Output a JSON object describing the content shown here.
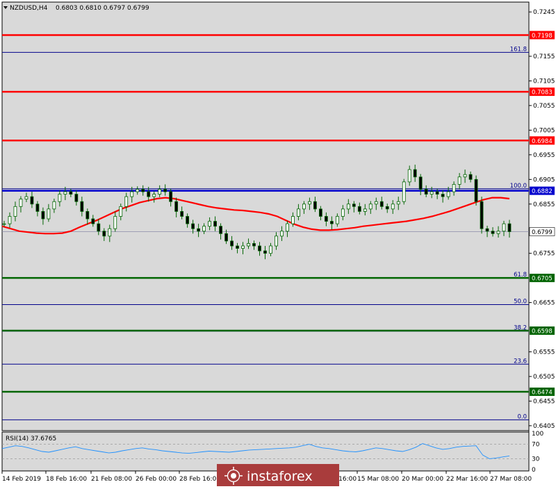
{
  "header": {
    "symbol": "NZDUSD,H4",
    "ohlc": "0.6803 0.6810 0.6797 0.6799"
  },
  "price_axis": {
    "ticks": [
      "0.7245",
      "0.7155",
      "0.7105",
      "0.7055",
      "0.7005",
      "0.6955",
      "0.6905",
      "0.6855",
      "0.6755",
      "0.6655",
      "0.6555",
      "0.6505",
      "0.6455",
      "0.6405"
    ]
  },
  "time_axis": {
    "ticks": [
      "14 Feb 2019",
      "18 Feb 16:00",
      "21 Feb 08:00",
      "26 Feb 00:00",
      "28 Feb 16:00",
      "13 Mar 16:00",
      "15 Mar 08:00",
      "20 Mar 00:00",
      "22 Mar 16:00",
      "27 Mar 08:00"
    ]
  },
  "rsi": {
    "title": "RSI(14) 37.6765",
    "scale": [
      "100",
      "70",
      "30",
      "0"
    ]
  },
  "watermark": "instaforex",
  "colors": {
    "red": "#ff0000",
    "green": "#006400",
    "fib": "#00008b",
    "current": "#0000cd",
    "rsi_line": "#1e90ff",
    "candle": "#006400"
  },
  "chart_data": {
    "type": "line",
    "instrument": "NZDUSD",
    "timeframe": "H4",
    "y_range": [
      0.6395,
      0.7265
    ],
    "levels": [
      {
        "price": 0.7198,
        "label": "0.7198",
        "color": "red"
      },
      {
        "price": 0.7083,
        "label": "0.7083",
        "color": "red"
      },
      {
        "price": 0.6984,
        "label": "0.6984",
        "color": "red"
      },
      {
        "price": 0.6882,
        "label": "0.6882",
        "color": "current"
      },
      {
        "price": 0.6705,
        "label": "0.6705",
        "color": "green"
      },
      {
        "price": 0.6598,
        "label": "0.6598",
        "color": "green"
      },
      {
        "price": 0.6474,
        "label": "0.6474",
        "color": "green"
      }
    ],
    "fib_levels": [
      {
        "price": 0.7163,
        "label": "161.8"
      },
      {
        "price": 0.6886,
        "label": "100.0"
      },
      {
        "price": 0.6705,
        "label": "61.8"
      },
      {
        "price": 0.6651,
        "label": "50.0"
      },
      {
        "price": 0.6597,
        "label": "38.2"
      },
      {
        "price": 0.653,
        "label": "23.6"
      },
      {
        "price": 0.6417,
        "label": "0.0"
      }
    ],
    "current_price": {
      "price": 0.6799,
      "label": "0.6799"
    },
    "price_series": [
      0.6815,
      0.683,
      0.685,
      0.6865,
      0.687,
      0.6855,
      0.684,
      0.6825,
      0.6845,
      0.686,
      0.6875,
      0.688,
      0.6875,
      0.686,
      0.684,
      0.6825,
      0.6815,
      0.68,
      0.679,
      0.6805,
      0.683,
      0.685,
      0.687,
      0.688,
      0.6885,
      0.688,
      0.687,
      0.6875,
      0.6885,
      0.688,
      0.686,
      0.684,
      0.683,
      0.6815,
      0.6805,
      0.68,
      0.681,
      0.682,
      0.681,
      0.6795,
      0.678,
      0.677,
      0.6765,
      0.677,
      0.6775,
      0.677,
      0.676,
      0.6755,
      0.677,
      0.679,
      0.68,
      0.6815,
      0.683,
      0.6845,
      0.6855,
      0.686,
      0.6845,
      0.683,
      0.682,
      0.6815,
      0.683,
      0.6845,
      0.6855,
      0.685,
      0.684,
      0.6845,
      0.6855,
      0.686,
      0.685,
      0.6845,
      0.6855,
      0.686,
      0.69,
      0.6925,
      0.691,
      0.6885,
      0.6875,
      0.688,
      0.6875,
      0.687,
      0.688,
      0.6895,
      0.691,
      0.6915,
      0.6905,
      0.686,
      0.6805,
      0.68,
      0.6795,
      0.68,
      0.6815,
      0.6799
    ],
    "ma_series": [
      0.681,
      0.6805,
      0.68,
      0.6798,
      0.6796,
      0.6795,
      0.6795,
      0.6796,
      0.68,
      0.6808,
      0.6815,
      0.6822,
      0.683,
      0.6838,
      0.6846,
      0.6852,
      0.6858,
      0.6862,
      0.6866,
      0.6868,
      0.6866,
      0.6862,
      0.6858,
      0.6854,
      0.685,
      0.6847,
      0.6845,
      0.6843,
      0.6842,
      0.684,
      0.6838,
      0.6835,
      0.683,
      0.6822,
      0.6814,
      0.6808,
      0.6804,
      0.6802,
      0.6802,
      0.6803,
      0.6805,
      0.6807,
      0.681,
      0.6812,
      0.6814,
      0.6816,
      0.6818,
      0.682,
      0.6823,
      0.6826,
      0.683,
      0.6835,
      0.684,
      0.6846,
      0.6852,
      0.6858,
      0.6864,
      0.6868,
      0.6868,
      0.6866
    ],
    "rsi_series": [
      58,
      62,
      66,
      64,
      60,
      55,
      50,
      48,
      52,
      56,
      60,
      63,
      58,
      55,
      52,
      49,
      46,
      48,
      52,
      55,
      58,
      60,
      57,
      55,
      52,
      50,
      48,
      46,
      45,
      47,
      49,
      51,
      50,
      49,
      48,
      50,
      52,
      54,
      55,
      56,
      57,
      58,
      59,
      60,
      62,
      66,
      70,
      64,
      60,
      58,
      55,
      52,
      50,
      49,
      52,
      56,
      60,
      58,
      55,
      52,
      50,
      55,
      62,
      72,
      66,
      60,
      56,
      58,
      62,
      64,
      65,
      66,
      40,
      30,
      32,
      35,
      37.68
    ],
    "rsi_levels": [
      70,
      30
    ]
  }
}
